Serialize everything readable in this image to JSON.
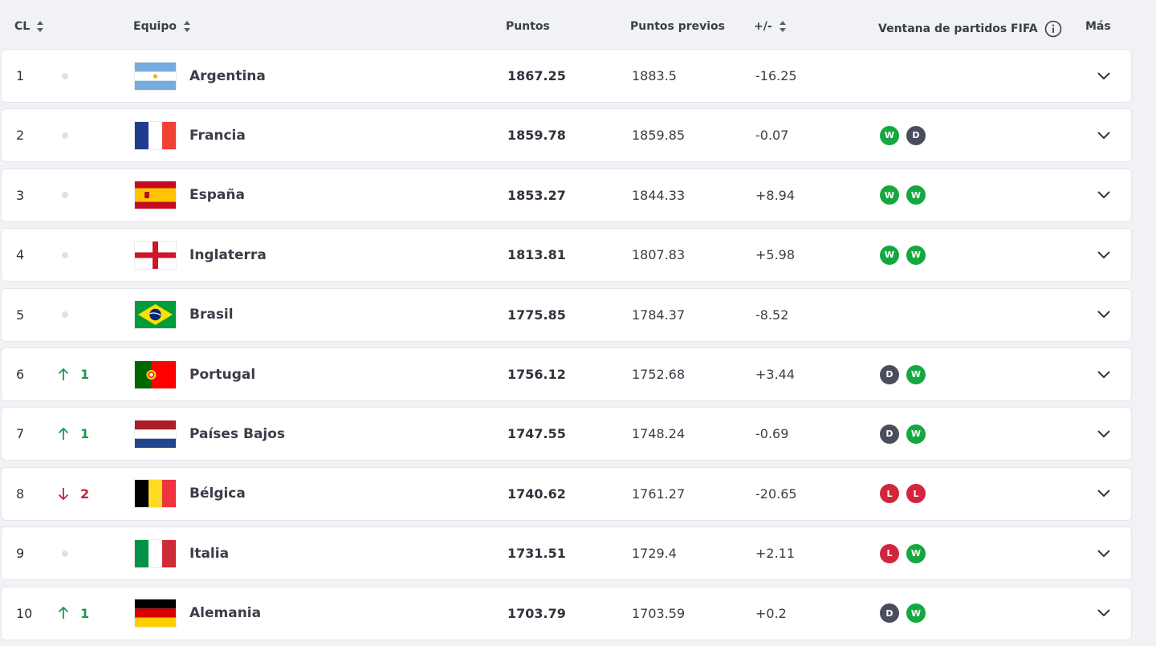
{
  "header": {
    "rank_label": "CL",
    "team_label": "Equipo",
    "points_label": "Puntos",
    "prev_points_label": "Puntos previos",
    "diff_label": "+/-",
    "window_label": "Ventana de partidos FIFA",
    "more_label": "Más"
  },
  "colors": {
    "win": "#14a83e",
    "draw": "#494d5c",
    "loss": "#d3253c",
    "up": "#1e9a4a",
    "down": "#c4223d"
  },
  "rows": [
    {
      "rank": "1",
      "move_dir": "none",
      "move": "",
      "flag": "argentina",
      "team": "Argentina",
      "points": "1867.25",
      "prev": "1883.5",
      "diff": "-16.25",
      "results": []
    },
    {
      "rank": "2",
      "move_dir": "none",
      "move": "",
      "flag": "france",
      "team": "Francia",
      "points": "1859.78",
      "prev": "1859.85",
      "diff": "-0.07",
      "results": [
        "W",
        "D"
      ]
    },
    {
      "rank": "3",
      "move_dir": "none",
      "move": "",
      "flag": "spain",
      "team": "España",
      "points": "1853.27",
      "prev": "1844.33",
      "diff": "+8.94",
      "results": [
        "W",
        "W"
      ]
    },
    {
      "rank": "4",
      "move_dir": "none",
      "move": "",
      "flag": "england",
      "team": "Inglaterra",
      "points": "1813.81",
      "prev": "1807.83",
      "diff": "+5.98",
      "results": [
        "W",
        "W"
      ]
    },
    {
      "rank": "5",
      "move_dir": "none",
      "move": "",
      "flag": "brazil",
      "team": "Brasil",
      "points": "1775.85",
      "prev": "1784.37",
      "diff": "-8.52",
      "results": []
    },
    {
      "rank": "6",
      "move_dir": "up",
      "move": "1",
      "flag": "portugal",
      "team": "Portugal",
      "points": "1756.12",
      "prev": "1752.68",
      "diff": "+3.44",
      "results": [
        "D",
        "W"
      ]
    },
    {
      "rank": "7",
      "move_dir": "up",
      "move": "1",
      "flag": "netherlands",
      "team": "Países Bajos",
      "points": "1747.55",
      "prev": "1748.24",
      "diff": "-0.69",
      "results": [
        "D",
        "W"
      ]
    },
    {
      "rank": "8",
      "move_dir": "down",
      "move": "2",
      "flag": "belgium",
      "team": "Bélgica",
      "points": "1740.62",
      "prev": "1761.27",
      "diff": "-20.65",
      "results": [
        "L",
        "L"
      ]
    },
    {
      "rank": "9",
      "move_dir": "none",
      "move": "",
      "flag": "italy",
      "team": "Italia",
      "points": "1731.51",
      "prev": "1729.4",
      "diff": "+2.11",
      "results": [
        "L",
        "W"
      ]
    },
    {
      "rank": "10",
      "move_dir": "up",
      "move": "1",
      "flag": "germany",
      "team": "Alemania",
      "points": "1703.79",
      "prev": "1703.59",
      "diff": "+0.2",
      "results": [
        "D",
        "W"
      ]
    }
  ]
}
